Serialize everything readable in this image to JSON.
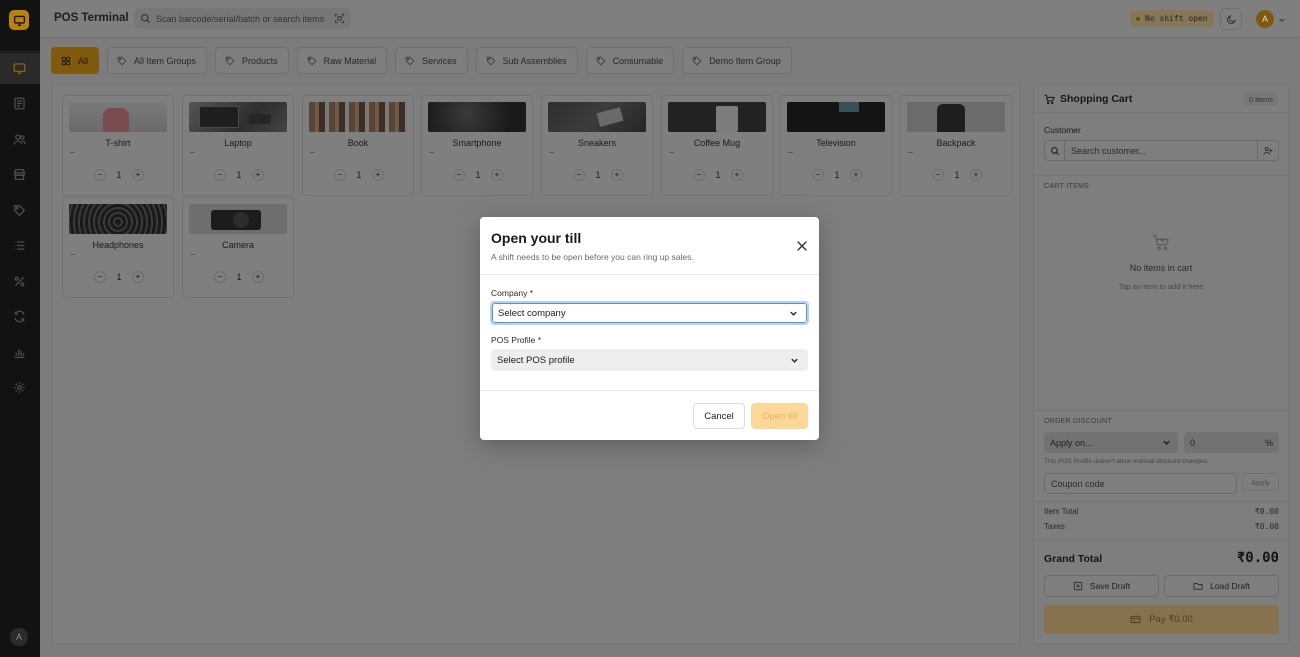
{
  "app": {
    "title": "POS Terminal"
  },
  "search": {
    "placeholder": "Scan barcode/serial/batch or search items"
  },
  "header": {
    "shift_status": "No shift open",
    "user_initial": "A"
  },
  "sidebar": {
    "items": [
      {
        "icon": "monitor-icon",
        "active": true
      },
      {
        "icon": "receipt-icon"
      },
      {
        "icon": "users-icon"
      },
      {
        "icon": "store-icon"
      },
      {
        "icon": "tag-icon"
      },
      {
        "icon": "list-icon"
      },
      {
        "icon": "percent-icon"
      },
      {
        "icon": "refresh-icon"
      },
      {
        "icon": "bar-chart-icon"
      },
      {
        "icon": "settings-icon"
      }
    ],
    "user_initial": "A"
  },
  "tabs": [
    {
      "label": "All",
      "active": true
    },
    {
      "label": "All Item Groups"
    },
    {
      "label": "Products"
    },
    {
      "label": "Raw Material"
    },
    {
      "label": "Services"
    },
    {
      "label": "Sub Assemblies"
    },
    {
      "label": "Consumable"
    },
    {
      "label": "Demo Item Group"
    }
  ],
  "products": [
    {
      "name": "T-shirt",
      "qty": "1",
      "thumb_color": "#6a6a6a"
    },
    {
      "name": "Laptop",
      "qty": "1",
      "thumb_color": "#3c3c3c"
    },
    {
      "name": "Book",
      "qty": "1",
      "thumb_color": "#4a3a2e"
    },
    {
      "name": "Smartphone",
      "qty": "1",
      "thumb_color": "#1c1c1c"
    },
    {
      "name": "Sneakers",
      "qty": "1",
      "thumb_color": "#2a2a2a"
    },
    {
      "name": "Coffee Mug",
      "qty": "1",
      "thumb_color": "#262626"
    },
    {
      "name": "Television",
      "qty": "1",
      "thumb_color": "#141414"
    },
    {
      "name": "Backpack",
      "qty": "1",
      "thumb_color": "#5e5e5e"
    },
    {
      "name": "Headphones",
      "qty": "1",
      "thumb_color": "#1e1e1e"
    },
    {
      "name": "Camera",
      "qty": "1",
      "thumb_color": "#6b6b6b"
    }
  ],
  "cart": {
    "title": "Shopping Cart",
    "count": "0 items",
    "customer_label": "Customer",
    "customer_placeholder": "Search customer...",
    "items_label": "CART ITEMS",
    "empty_title": "No items in cart",
    "empty_sub": "Tap an item to add it here",
    "discount_label": "ORDER DISCOUNT",
    "discount_apply_on": "Apply on...",
    "discount_value": "0",
    "discount_unit": "%",
    "discount_note": "This POS Profile doesn't allow manual discount changes.",
    "coupon_placeholder": "Coupon code",
    "apply_label": "Apply",
    "item_total_label": "Item Total",
    "item_total_value": "₹0.00",
    "taxes_label": "Taxes",
    "taxes_value": "₹0.00",
    "grand_total_label": "Grand Total",
    "grand_total_value": "₹0.00",
    "save_draft_label": "Save Draft",
    "load_draft_label": "Load Draft",
    "pay_label": "Pay ₹0.00"
  },
  "modal": {
    "title": "Open your till",
    "subtitle": "A shift needs to be open before you can ring up sales.",
    "company_label": "Company *",
    "company_value": "Select company",
    "profile_label": "POS Profile *",
    "profile_value": "Select POS profile",
    "cancel_label": "Cancel",
    "open_label": "Open till"
  },
  "colors": {
    "accent": "#f5a623",
    "accent_disabled": "#fbd79a",
    "sidebar_bg": "#121212",
    "overlay": "rgba(0,0,0,0.5)"
  }
}
